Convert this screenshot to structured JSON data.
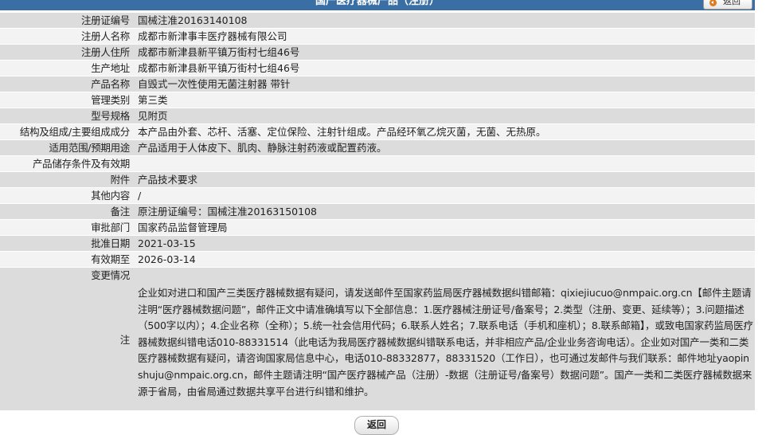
{
  "header": {
    "title": "国产医疗器械产品（注册）",
    "back_label": "返回"
  },
  "rows": [
    {
      "label": "注册证编号",
      "value": "国械注准20163140108"
    },
    {
      "label": "注册人名称",
      "value": "成都市新津事丰医疗器械有限公司"
    },
    {
      "label": "注册人住所",
      "value": "成都市新津县新平镇万街村七组46号"
    },
    {
      "label": "生产地址",
      "value": "成都市新津县新平镇万街村七组46号"
    },
    {
      "label": "产品名称",
      "value": "自毁式一次性使用无菌注射器 带针"
    },
    {
      "label": "管理类别",
      "value": "第三类"
    },
    {
      "label": "型号规格",
      "value": "见附页"
    },
    {
      "label": "结构及组成/主要组成成分",
      "value": "本产品由外套、芯杆、活塞、定位保险、注射针组成。产品经环氧乙烷灭菌，无菌、无热原。"
    },
    {
      "label": "适用范围/预期用途",
      "value": "产品适用于人体皮下、肌肉、静脉注射药液或配置药液。"
    },
    {
      "label": "产品储存条件及有效期",
      "value": ""
    },
    {
      "label": "附件",
      "value": "产品技术要求"
    },
    {
      "label": "其他内容",
      "value": "/"
    },
    {
      "label": "备注",
      "value": "原注册证编号：国械注准20163150108"
    },
    {
      "label": "审批部门",
      "value": "国家药品监督管理局"
    },
    {
      "label": "批准日期",
      "value": "2021-03-15"
    },
    {
      "label": "有效期至",
      "value": "2026-03-14"
    },
    {
      "label": "变更情况",
      "value": ""
    }
  ],
  "note": {
    "label": "注",
    "text": "企业如对进口和国产三类医疗器械数据有疑问，请发送邮件至国家药监局医疗器械数据纠错邮箱：qixiejiucuo@nmpaic.org.cn【邮件主题请注明“医疗器械数据问题”，邮件正文中请准确填写以下全部信息：1.医疗器械注册证号/备案号；2.类型（注册、变更、延续等）；3.问题描述（500字以内）；4.企业名称（全称）；5.统一社会信用代码；6.联系人姓名；7.联系电话（手机和座机）；8.联系邮箱】，或致电国家药监局医疗器械数据纠错电话010-88331514（此电话为我局医疗器械数据纠错联系电话，并非相应产品/企业业务咨询电话）。企业如对国产一类和二类医疗器械数据有疑问，请咨询国家局信息中心，电话010-88332877，88331520（工作日），也可通过发邮件与我们联系：邮件地址yaopinshuju@nmpaic.org.cn，邮件主题请注明“国产医疗器械产品（注册）-数据（注册证号/备案号）数据问题”。国产一类和二类医疗器械数据来源于省局，由省局通过数据共享平台进行纠错和维护。"
  },
  "footer": {
    "back_label": "返回"
  }
}
